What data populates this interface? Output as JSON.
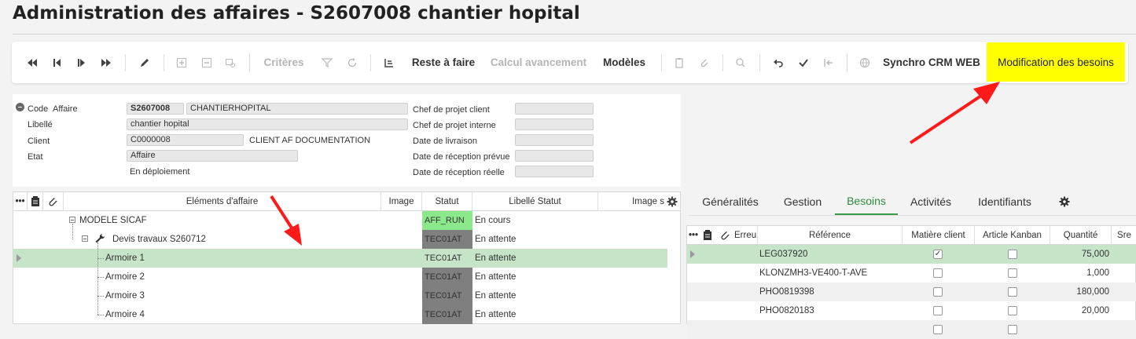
{
  "page_title": "Administration des affaires - S2607008 chantier hopital",
  "toolbar": {
    "criteres": "Critères",
    "reste_a_faire": "Reste à faire",
    "calcul_avancement": "Calcul avancement",
    "modeles": "Modèles",
    "synchro_crm": "Synchro CRM WEB",
    "modification_besoins": "Modification des besoins"
  },
  "form": {
    "code_label": "Code",
    "affaire_label": "Affaire",
    "code_value": "S2607008",
    "code_name": "CHANTIERHOPITAL",
    "libelle_label": "Libellé",
    "libelle_value": "chantier hopital",
    "client_label": "Client",
    "client_code": "C0000008",
    "client_name": "CLIENT AF  DOCUMENTATION",
    "etat_label": "Etat",
    "etat_value": "Affaire",
    "etat_sub": "En déploiement",
    "chef_client_label": "Chef de projet client",
    "chef_interne_label": "Chef de projet interne",
    "date_livraison_label": "Date de livraison",
    "date_reception_prevue_label": "Date de réception prévue",
    "date_reception_reelle_label": "Date de réception réelle"
  },
  "left_grid": {
    "headers": [
      "Eléments d'affaire",
      "Image",
      "Statut",
      "Libellé Statut",
      "Image s"
    ],
    "rows": [
      {
        "name": "MODELE SICAF",
        "status": "AFF_RUN",
        "label": "En cours",
        "status_color": "#8be88b"
      },
      {
        "name": "Devis travaux S260712",
        "status": "TEC01AT",
        "label": "En attente",
        "status_color": "#7f7f7f"
      },
      {
        "name": "Armoire 1",
        "status": "TEC01AT",
        "label": "En attente",
        "status_color": ""
      },
      {
        "name": "Armoire 2",
        "status": "TEC01AT",
        "label": "En attente",
        "status_color": "#7f7f7f"
      },
      {
        "name": "Armoire 3",
        "status": "TEC01AT",
        "label": "En attente",
        "status_color": "#7f7f7f"
      },
      {
        "name": "Armoire 4",
        "status": "TEC01AT",
        "label": "En attente",
        "status_color": "#7f7f7f"
      }
    ]
  },
  "tabs": [
    "Généralités",
    "Gestion",
    "Besoins",
    "Activités",
    "Identifiants"
  ],
  "right_grid": {
    "headers": [
      "Erreu",
      "Référence",
      "Matière client",
      "Article Kanban",
      "Quantité",
      "Sre"
    ],
    "rows": [
      {
        "ref": "LEG037920",
        "matiere": true,
        "kanban": false,
        "qty": "75,000"
      },
      {
        "ref": "KLONZMH3-VE400-T-AVE",
        "matiere": false,
        "kanban": false,
        "qty": "1,000"
      },
      {
        "ref": "PHO0819398",
        "matiere": false,
        "kanban": false,
        "qty": "180,000"
      },
      {
        "ref": "PHO0820183",
        "matiere": false,
        "kanban": false,
        "qty": "20,000"
      }
    ]
  },
  "colors": {
    "accent_green": "#3a9a48",
    "selection": "#c6e4c8",
    "highlight_yellow": "#ffff00",
    "arrow_red": "#ff1a1a"
  }
}
